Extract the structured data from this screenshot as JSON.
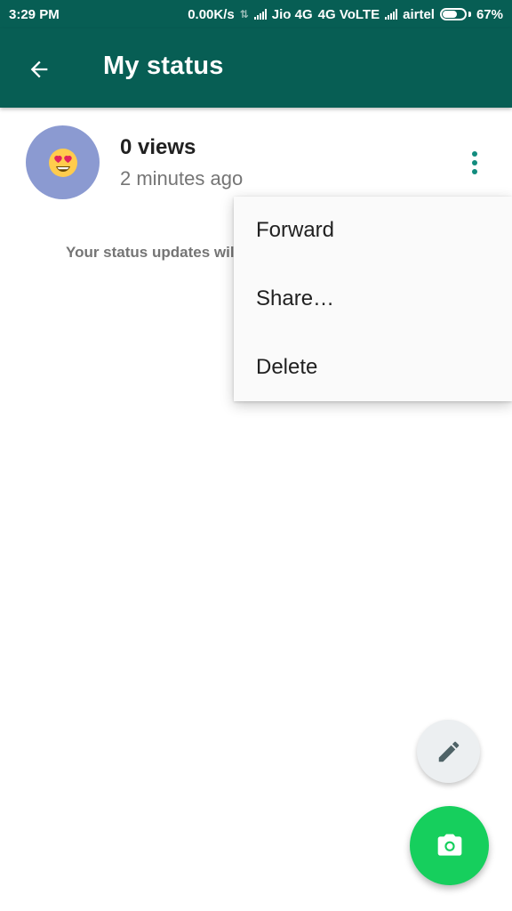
{
  "status_bar": {
    "time": "3:29 PM",
    "network_speed": "0.00K/s",
    "carrier1": "Jio 4G",
    "network_type": "4G VoLTE",
    "carrier2": "airtel",
    "battery": "67%",
    "battery_level": 0.67
  },
  "app_bar": {
    "title": "My status",
    "back_icon": "arrow-left-icon"
  },
  "status_item": {
    "views": "0 views",
    "time_ago": "2 minutes ago",
    "avatar_emoji": "😍",
    "avatar_color": "#8b9ad1"
  },
  "privacy_note": "Your status updates will disappear after 24 hours.",
  "menu": {
    "items": [
      "Forward",
      "Share…",
      "Delete"
    ]
  },
  "fabs": {
    "pencil_icon": "pencil-icon",
    "camera_icon": "camera-icon",
    "camera_color": "#16cf5d"
  },
  "colors": {
    "primary": "#075e54",
    "accent": "#128c7e"
  }
}
